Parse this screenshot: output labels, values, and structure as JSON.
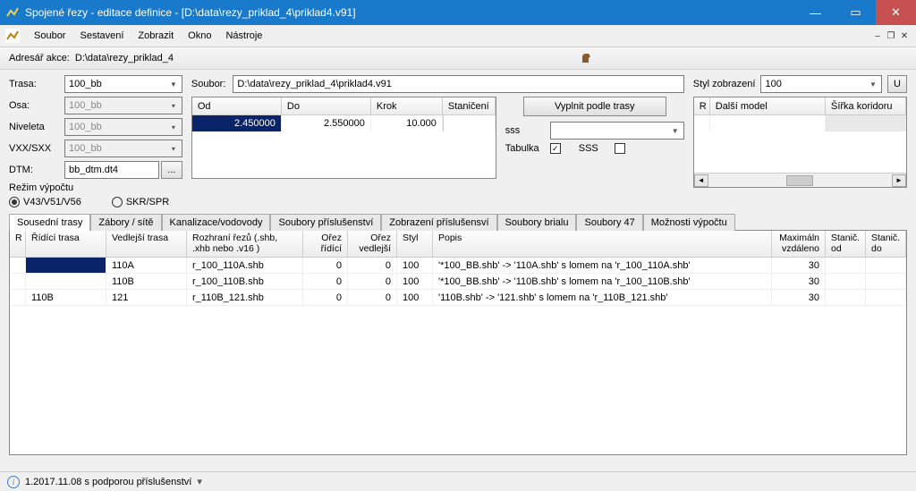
{
  "title": "Spojené řezy - editace definice - [D:\\data\\rezy_priklad_4\\priklad4.v91]",
  "menu": {
    "soubor": "Soubor",
    "sestaveni": "Sestavení",
    "zobrazit": "Zobrazit",
    "okno": "Okno",
    "nastroje": "Nástroje"
  },
  "addr": {
    "label": "Adresář akce:",
    "value": "D:\\data\\rezy_priklad_4"
  },
  "left": {
    "trasa_lbl": "Trasa:",
    "trasa_val": "100_bb",
    "osa_lbl": "Osa:",
    "osa_val": "100_bb",
    "niveleta_lbl": "Niveleta",
    "niveleta_val": "100_bb",
    "vxx_lbl": "VXX/SXX",
    "vxx_val": "100_bb",
    "dtm_lbl": "DTM:",
    "dtm_val": "bb_dtm.dt4",
    "dtm_btn": "...",
    "rezim_lbl": "Režim výpočtu",
    "radio1": "V43/V51/V56",
    "radio2": "SKR/SPR"
  },
  "mid": {
    "soubor_lbl": "Soubor:",
    "soubor_val": "D:\\data\\rezy_priklad_4\\priklad4.v91",
    "hdr": {
      "od": "Od",
      "do": "Do",
      "krok": "Krok",
      "staniceni": "Staničení"
    },
    "row": {
      "od": "2.450000",
      "do": "2.550000",
      "krok": "10.000"
    },
    "vyplnit": "Vyplnit podle trasy",
    "sss": "sss",
    "tabulka": "Tabulka",
    "sss2": "SSS"
  },
  "style": {
    "lbl": "Styl zobrazení",
    "val": "100",
    "u": "U",
    "hdr": {
      "r": "R",
      "model": "Další model",
      "sirka": "Šířka koridoru"
    }
  },
  "tabs": {
    "t1": "Sousední trasy",
    "t2": "Zábory / sítě",
    "t3": "Kanalizace/vodovody",
    "t4": "Soubory příslušenství",
    "t5": "Zobrazení příslušensví",
    "t6": "Soubory brialu",
    "t7": "Soubory 47",
    "t8": "Možnosti výpočtu"
  },
  "grid": {
    "hdr": {
      "r": "R",
      "ridici": "Řídící trasa",
      "vedl": "Vedlejší trasa",
      "rozh": "Rozhraní řezů (.shb, .xhb nebo .v16 )",
      "orez1": "Ořez řídící",
      "orez2": "Ořez vedlejší",
      "styl": "Styl",
      "popis": "Popis",
      "max": "Maximáln vzdáleno",
      "stod": "Stanič. od",
      "stdo": "Stanič. do"
    },
    "rows": [
      {
        "ridici": "",
        "vedl": "110A",
        "rozh": "r_100_110A.shb",
        "o1": "0",
        "o2": "0",
        "styl": "100",
        "popis": "'*100_BB.shb' -> '110A.shb' s lomem na 'r_100_110A.shb'",
        "max": "30"
      },
      {
        "ridici": "",
        "vedl": "110B",
        "rozh": "r_100_110B.shb",
        "o1": "0",
        "o2": "0",
        "styl": "100",
        "popis": "'*100_BB.shb' -> '110B.shb' s lomem na 'r_100_110B.shb'",
        "max": "30"
      },
      {
        "ridici": "110B",
        "vedl": "121",
        "rozh": "r_110B_121.shb",
        "o1": "0",
        "o2": "0",
        "styl": "100",
        "popis": "'110B.shb' -> '121.shb' s lomem na 'r_110B_121.shb'",
        "max": "30"
      }
    ]
  },
  "status": "1.2017.11.08 s podporou příslušenství"
}
